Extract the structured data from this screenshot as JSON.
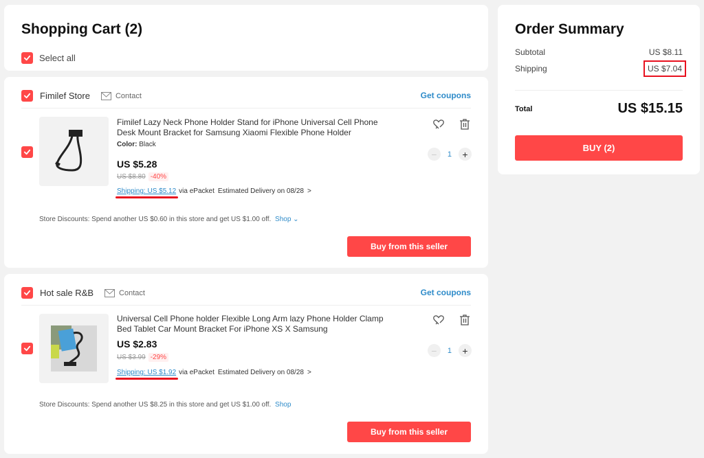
{
  "cart": {
    "title": "Shopping Cart (2)",
    "select_all_label": "Select all"
  },
  "stores": [
    {
      "name": "Fimilef Store",
      "contact_label": "Contact",
      "coupons_label": "Get coupons",
      "item": {
        "title": "Fimilef Lazy Neck Phone Holder Stand for iPhone Universal Cell Phone Desk Mount Bracket for Samsung Xiaomi Flexible Phone Holder",
        "color_label": "Color:",
        "color_value": "Black",
        "price": "US $5.28",
        "original_price": "US $8.80",
        "discount": "-40%",
        "shipping_link": "Shipping: US $5.12",
        "shipping_via": "via ePacket",
        "delivery": "Estimated Delivery on 08/28",
        "quantity": "1"
      },
      "discount_text": "Store Discounts:  Spend another US $0.60 in this store and get US $1.00 off.",
      "shop_label": "Shop",
      "buy_label": "Buy from this seller"
    },
    {
      "name": "Hot sale R&B",
      "contact_label": "Contact",
      "coupons_label": "Get coupons",
      "item": {
        "title": "Universal Cell Phone holder Flexible Long Arm lazy Phone Holder Clamp Bed Tablet Car Mount Bracket For iPhone XS X Samsung",
        "price": "US $2.83",
        "original_price": "US $3.99",
        "discount": "-29%",
        "shipping_link": "Shipping: US $1.92",
        "shipping_via": "via ePacket",
        "delivery": "Estimated Delivery on 08/28",
        "quantity": "1"
      },
      "discount_text": "Store Discounts:  Spend another US $8.25 in this store and get US $1.00 off.",
      "shop_label": "Shop",
      "buy_label": "Buy from this seller"
    }
  ],
  "summary": {
    "title": "Order Summary",
    "subtotal_label": "Subtotal",
    "subtotal_value": "US $8.11",
    "shipping_label": "Shipping",
    "shipping_value": "US $7.04",
    "total_label": "Total",
    "total_value": "US $15.15",
    "buy_label": "BUY (2)"
  },
  "colors": {
    "accent_red": "#ff4747",
    "link_blue": "#2e8bc9",
    "highlight_red": "#e8101e"
  }
}
